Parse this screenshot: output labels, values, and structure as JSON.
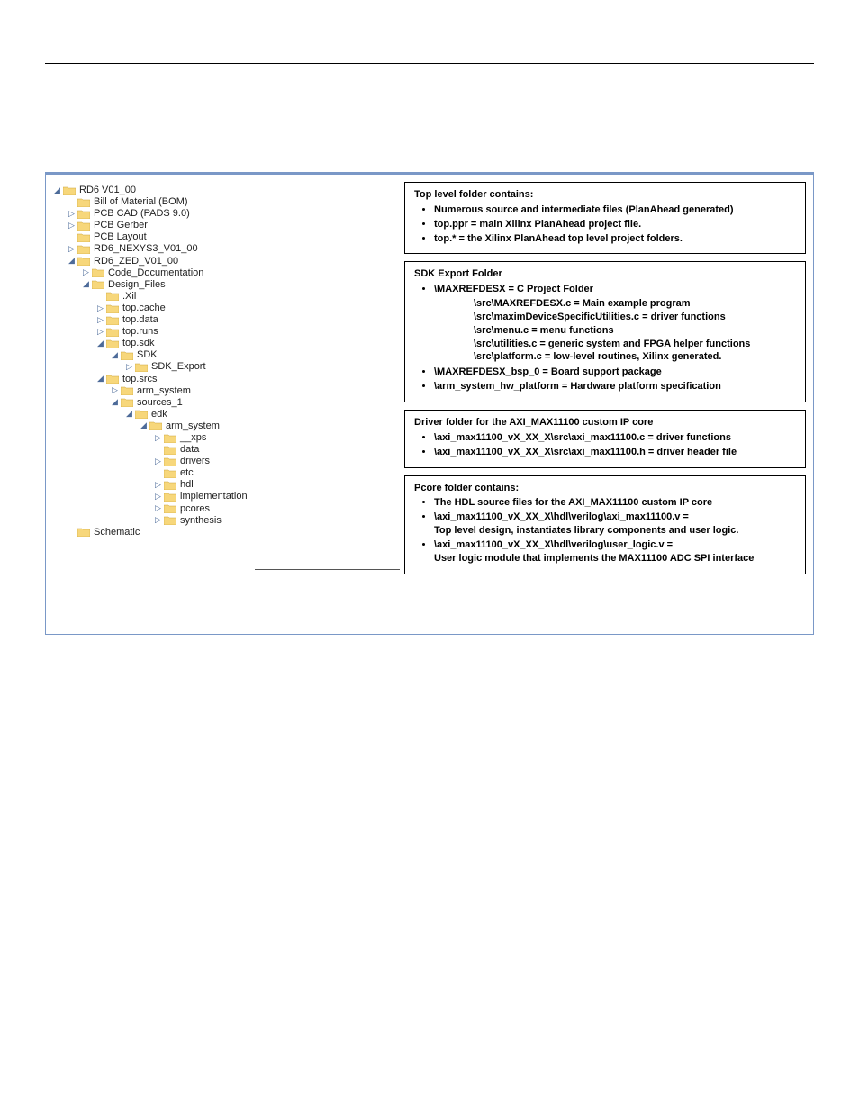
{
  "tree": {
    "n0": "RD6 V01_00",
    "n1": "Bill of Material (BOM)",
    "n2": "PCB CAD (PADS 9.0)",
    "n3": "PCB Gerber",
    "n4": "PCB Layout",
    "n5": "RD6_NEXYS3_V01_00",
    "n6": "RD6_ZED_V01_00",
    "n7": "Code_Documentation",
    "n8": "Design_Files",
    "n9": ".Xil",
    "n10": "top.cache",
    "n11": "top.data",
    "n12": "top.runs",
    "n13": "top.sdk",
    "n14": "SDK",
    "n15": "SDK_Export",
    "n16": "top.srcs",
    "n17": "arm_system",
    "n18": "sources_1",
    "n19": "edk",
    "n20": "arm_system",
    "n21": "__xps",
    "n22": "data",
    "n23": "drivers",
    "n24": "etc",
    "n25": "hdl",
    "n26": "implementation",
    "n27": "pcores",
    "n28": "synthesis",
    "n29": "Schematic"
  },
  "box1": {
    "title": "Top level folder contains:",
    "b1": "Numerous source and intermediate files (PlanAhead generated)",
    "b2": "top.ppr = main Xilinx PlanAhead project file.",
    "b3": "top.* = the Xilinx PlanAhead top level project folders."
  },
  "box2": {
    "title": "SDK Export Folder",
    "b1": "\\MAXREFDESX = C Project Folder",
    "s1": "\\src\\MAXREFDESX.c  = Main example program",
    "s2": "\\src\\maximDeviceSpecificUtilities.c = driver functions",
    "s3": "\\src\\menu.c = menu functions",
    "s4": "\\src\\utilities.c = generic system and FPGA helper functions",
    "s5": "\\src\\platform.c = low-level routines, Xilinx generated.",
    "b2": "\\MAXREFDESX_bsp_0 = Board support package",
    "b3": "\\arm_system_hw_platform = Hardware platform specification"
  },
  "box3": {
    "title": "Driver folder for the AXI_MAX11100 custom IP core",
    "b1": "\\axi_max11100_vX_XX_X\\src\\axi_max11100.c = driver functions",
    "b2": "\\axi_max11100_vX_XX_X\\src\\axi_max11100.h = driver header file"
  },
  "box4": {
    "title": "Pcore folder contains:",
    "b1": "The HDL source files for the AXI_MAX11100 custom IP core",
    "b2a": "\\axi_max11100_vX_XX_X\\hdl\\verilog\\axi_max11100.v =",
    "b2b": "Top level design, instantiates library components and user logic.",
    "b3a": "\\axi_max11100_vX_XX_X\\hdl\\verilog\\user_logic.v =",
    "b3b": "User logic module that implements the MAX11100 ADC SPI interface"
  }
}
